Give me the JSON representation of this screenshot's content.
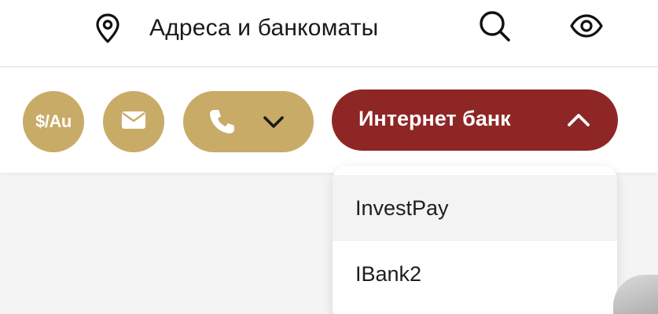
{
  "header": {
    "addresses_label": "Адреса и банкоматы",
    "icons": {
      "location": "location-pin-icon",
      "search": "search-icon",
      "visibility": "eye-icon"
    }
  },
  "toolbar": {
    "rates_label": "$/Au",
    "icons": {
      "mail": "mail-icon",
      "phone": "phone-icon",
      "phone_menu": "chevron-down-icon",
      "ibank_menu": "chevron-up-icon"
    },
    "internet_bank": {
      "label": "Интернет банк",
      "expanded": true,
      "menu": [
        {
          "label": "InvestPay"
        },
        {
          "label": "IBank2"
        }
      ]
    }
  },
  "colors": {
    "gold": "#c9ab68",
    "burgundy": "#8e2626",
    "background": "#f4f4f4",
    "surface": "#ffffff",
    "text": "#1a1a1a"
  }
}
